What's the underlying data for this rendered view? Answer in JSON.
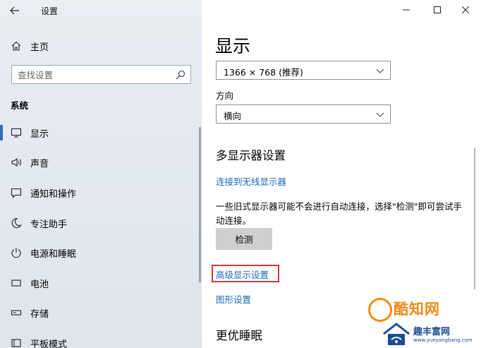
{
  "window": {
    "app_title": "设置",
    "buttons": [
      "minimize",
      "maximize",
      "close"
    ]
  },
  "sidebar": {
    "home_label": "主页",
    "search_placeholder": "查找设置",
    "section_label": "系统",
    "items": [
      {
        "label": "显示",
        "icon": "monitor-icon",
        "active": true
      },
      {
        "label": "声音",
        "icon": "speaker-icon",
        "active": false
      },
      {
        "label": "通知和操作",
        "icon": "message-icon",
        "active": false
      },
      {
        "label": "专注助手",
        "icon": "moon-icon",
        "active": false
      },
      {
        "label": "电源和睡眠",
        "icon": "power-icon",
        "active": false
      },
      {
        "label": "电池",
        "icon": "battery-icon",
        "active": false
      },
      {
        "label": "存储",
        "icon": "storage-icon",
        "active": false
      },
      {
        "label": "平板模式",
        "icon": "tablet-icon",
        "active": false
      }
    ]
  },
  "main": {
    "page_title": "显示",
    "resolution_value": "1366 × 768 (推荐)",
    "orientation_label": "方向",
    "orientation_value": "横向",
    "multi_display_title": "多显示器设置",
    "wireless_link": "连接到无线显示器",
    "detect_description": "一些旧式显示器可能不会进行自动连接，选择\"检测\"即可尝试手动连接。",
    "detect_button": "检测",
    "advanced_link": "高级显示设置",
    "graphics_link": "图形设置",
    "night_title": "更优睡眠"
  },
  "watermark": {
    "brand1": "酷知网",
    "brand2": "趣丰富网",
    "url": "www.yueyangbang.com"
  },
  "colors": {
    "accent": "#2e6fb5",
    "link": "#1a6bb8",
    "highlight_border": "#d9353b",
    "sidebar_bg": "#e3e9ef"
  }
}
